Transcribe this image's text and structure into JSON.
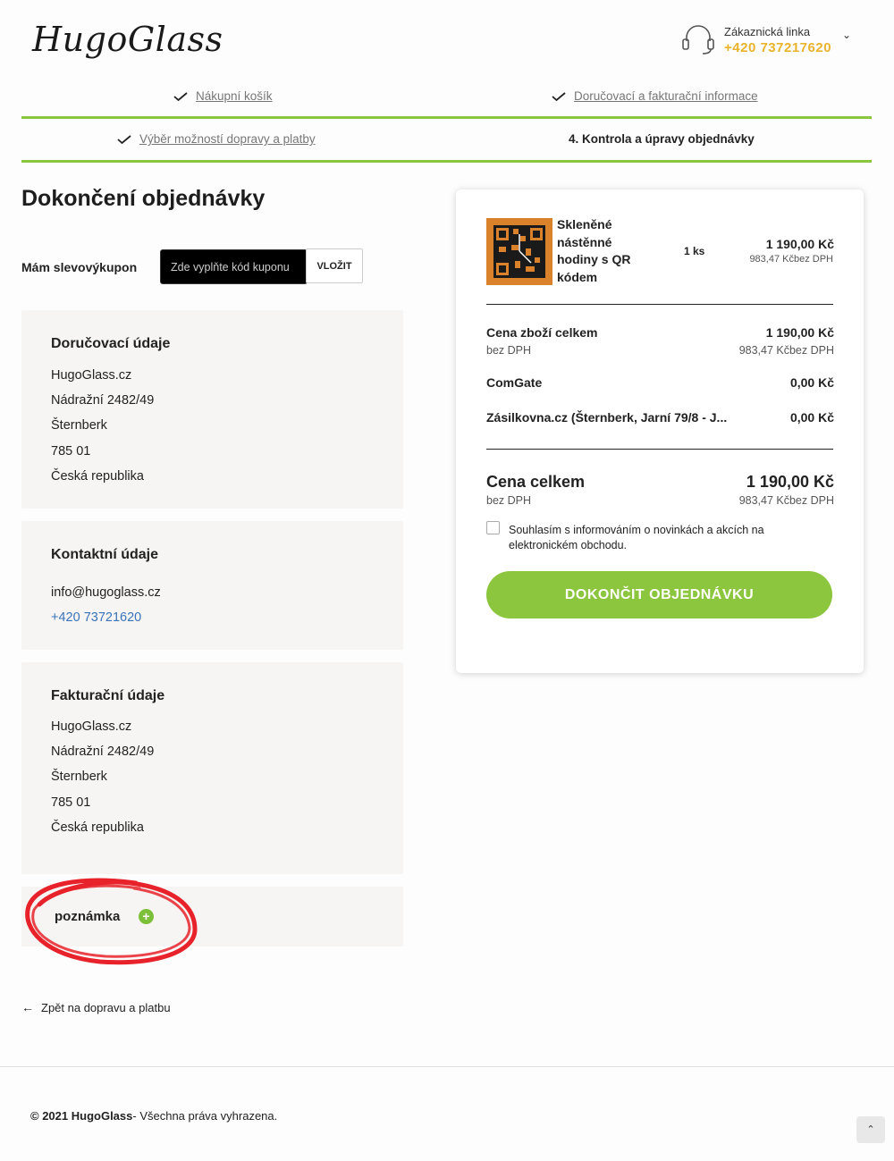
{
  "header": {
    "logo_text": "HugoGlass",
    "hotline_label": "Zákaznická linka",
    "hotline_phone": "+420 737217620"
  },
  "steps": [
    {
      "label": "Nákupní košík",
      "done": true
    },
    {
      "label": "Doručovací a fakturační informace",
      "done": true
    },
    {
      "label": "Výběr možností dopravy a platby",
      "done": true
    },
    {
      "label": "4. Kontrola a úpravy objednávky",
      "done": false,
      "active": true
    }
  ],
  "page": {
    "title": "Dokončení objednávky"
  },
  "coupon": {
    "label": "Mám slevovýkupon",
    "placeholder": "Zde vyplňte kód kuponu",
    "button": "VLOŽIT"
  },
  "delivery": {
    "title": "Doručovací údaje",
    "lines": [
      "HugoGlass.cz",
      "Nádražní 2482/49",
      "Šternberk",
      "785 01",
      "Česká republika"
    ]
  },
  "contact": {
    "title": "Kontaktní údaje",
    "email": "info@hugoglass.cz",
    "phone": "+420 73721620"
  },
  "billing": {
    "title": "Fakturační údaje",
    "lines": [
      "HugoGlass.cz",
      "Nádražní 2482/49",
      "Šternberk",
      "785 01",
      "Česká republika"
    ]
  },
  "note": {
    "label": "poznámka"
  },
  "back_link": "Zpět na dopravu a platbu",
  "summary": {
    "product": {
      "name": "Skleněné nástěnné hodiny s QR kódem",
      "qty": "1 ks",
      "price": "1 190,00 Kč",
      "price_no_vat": "983,47 Kčbez DPH"
    },
    "goods_total_label": "Cena zboží celkem",
    "goods_total": "1 190,00 Kč",
    "goods_sub_label": "bez DPH",
    "goods_sub": "983,47 Kčbez DPH",
    "payment_label": "ComGate",
    "payment_price": "0,00 Kč",
    "shipping_label": "Zásilkovna.cz (Šternberk, Jarní 79/8 - J...",
    "shipping_price": "0,00 Kč",
    "total_label": "Cena celkem",
    "total": "1 190,00 Kč",
    "total_sub_label": "bez DPH",
    "total_sub": "983,47 Kčbez DPH",
    "consent": "Souhlasím s informováním o novinkách a akcích na elektronickém obchodu.",
    "finish_button": "DOKONČIT OBJEDNÁVKU"
  },
  "footer": {
    "year": "© 2021",
    "brand": "HugoGlass",
    "rights": "- Všechna práva vyhrazena."
  },
  "colors": {
    "accent": "#8cc63f",
    "phone": "#e9b32b",
    "link": "#3a73b8",
    "panel_bg": "#f6f5f4"
  }
}
